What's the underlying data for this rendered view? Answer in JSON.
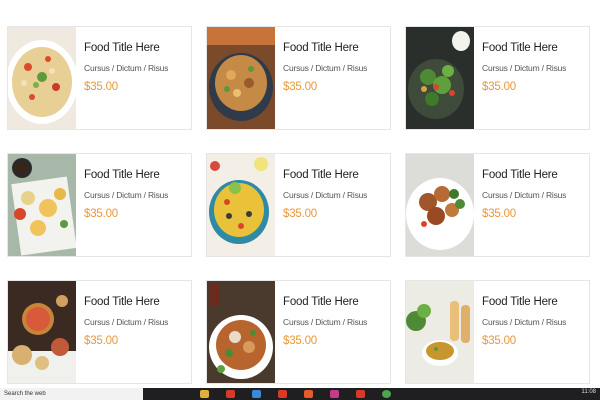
{
  "cards": [
    {
      "title": "Food Title Here",
      "categories": "Cursus / Dictum / Risus",
      "price": "$35.00",
      "image": "rice-salad-dish"
    },
    {
      "title": "Food Title Here",
      "categories": "Cursus / Dictum / Risus",
      "price": "$35.00",
      "image": "stir-fry-bowl"
    },
    {
      "title": "Food Title Here",
      "categories": "Cursus / Dictum / Risus",
      "price": "$35.00",
      "image": "green-salad-dish"
    },
    {
      "title": "Food Title Here",
      "categories": "Cursus / Dictum / Risus",
      "price": "$35.00",
      "image": "appetizer-platter"
    },
    {
      "title": "Food Title Here",
      "categories": "Cursus / Dictum / Risus",
      "price": "$35.00",
      "image": "yellow-rice-bowl"
    },
    {
      "title": "Food Title Here",
      "categories": "Cursus / Dictum / Risus",
      "price": "$35.00",
      "image": "grilled-chicken-plate"
    },
    {
      "title": "Food Title Here",
      "categories": "Cursus / Dictum / Risus",
      "price": "$35.00",
      "image": "pizza-spread"
    },
    {
      "title": "Food Title Here",
      "categories": "Cursus / Dictum / Risus",
      "price": "$35.00",
      "image": "noodle-plate"
    },
    {
      "title": "Food Title Here",
      "categories": "Cursus / Dictum / Risus",
      "price": "$35.00",
      "image": "soup-and-rolls"
    }
  ],
  "colors": {
    "price": "#e8983a",
    "title": "#222222",
    "border": "#e6e6e6",
    "taskbar": "#1f1f22"
  },
  "taskbar": {
    "search_text": "Search the web",
    "clock": "11:08"
  }
}
